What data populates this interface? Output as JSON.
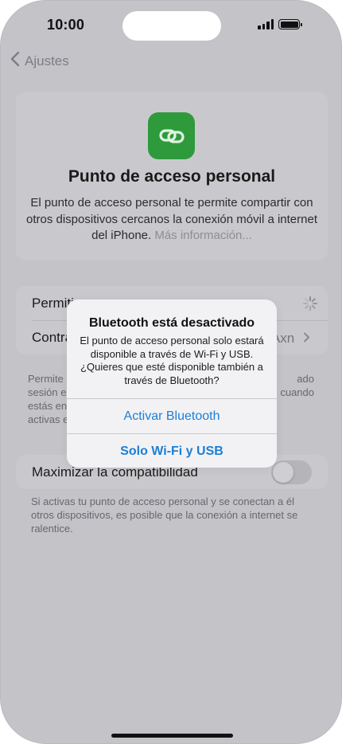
{
  "status_bar": {
    "time": "10:00",
    "icons": [
      "cellular-signal-icon",
      "battery-icon"
    ]
  },
  "nav": {
    "back_label": "Ajustes",
    "back_icon": "chevron-left-icon"
  },
  "header": {
    "icon": "link-chain-icon",
    "icon_color": "#2e9a3c",
    "title": "Punto de acceso personal",
    "description": "El punto de acceso personal te permite compartir con otros dispositivos cercanos la conexión móvil a internet del iPhone.",
    "more_link": "Más información..."
  },
  "settings": {
    "rows": [
      {
        "label": "Permiti",
        "state": "loading"
      },
      {
        "label": "Contra",
        "value": "Axn"
      }
    ]
  },
  "footnote1_lines": [
    {
      "left": "Permite",
      "right": "ado"
    },
    {
      "left": "sesión e",
      "right": "cuando"
    },
    {
      "left": "estás en",
      "right": ""
    },
    {
      "left": "activas e",
      "right": ""
    }
  ],
  "compat": {
    "label": "Maximizar la compatibilidad",
    "toggle_on": false
  },
  "footnote2": "Si activas tu punto de acceso personal y se conectan a él otros dispositivos, es posible que la conexión a internet se ralentice.",
  "alert": {
    "title": "Bluetooth está desactivado",
    "message": "El punto de acceso personal solo estará disponible a través de Wi-Fi y USB. ¿Quieres que esté disponible también a través de Bluetooth?",
    "buttons": [
      "Activar Bluetooth",
      "Solo Wi-Fi y USB"
    ],
    "accent_color": "#1d7ed6"
  }
}
